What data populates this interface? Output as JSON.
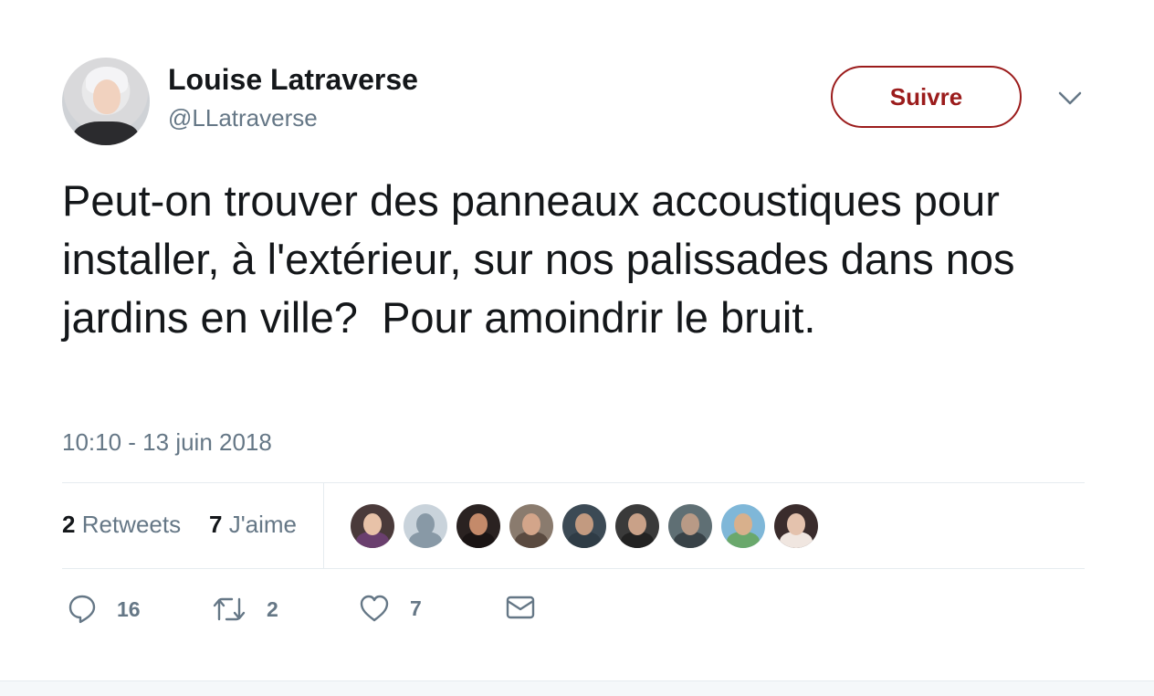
{
  "author": {
    "name": "Louise Latraverse",
    "handle": "@LLatraverse"
  },
  "follow_button": {
    "label": "Suivre"
  },
  "tweet": {
    "text": "Peut-on trouver des panneaux accoustiques pour installer, à l'extérieur, sur nos palissades dans nos jardins en ville?  Pour amoindrir le bruit.",
    "timestamp": "10:10 - 13 juin 2018"
  },
  "stats": {
    "retweets_count": "2",
    "retweets_label": "Retweets",
    "likes_count": "7",
    "likes_label": "J'aime"
  },
  "likers": [
    {
      "icon": "avatar-woman-dark-hair",
      "bg": "#4a3a3a",
      "face": "#e8c2a8",
      "body": "#6a3f6e"
    },
    {
      "icon": "avatar-default-silhouette",
      "bg": "#c9d3db",
      "face": "#8899a6",
      "body": "#8899a6"
    },
    {
      "icon": "avatar-woman-black-hair",
      "bg": "#2a2221",
      "face": "#c48a6a",
      "body": "#1a1414"
    },
    {
      "icon": "avatar-man-beard",
      "bg": "#8a7b6e",
      "face": "#d3a58a",
      "body": "#5a4a40"
    },
    {
      "icon": "avatar-man-glasses",
      "bg": "#3c4a55",
      "face": "#c29a80",
      "body": "#2f3c46"
    },
    {
      "icon": "avatar-man-bald",
      "bg": "#3a3a3a",
      "face": "#c9a188",
      "body": "#222222"
    },
    {
      "icon": "avatar-two-people",
      "bg": "#5f6f74",
      "face": "#b89a86",
      "body": "#384247"
    },
    {
      "icon": "avatar-person-outdoors",
      "bg": "#7fb7d8",
      "face": "#d8b08c",
      "body": "#6aa86c"
    },
    {
      "icon": "avatar-woman-blonde",
      "bg": "#3a2c2c",
      "face": "#e4c2ad",
      "body": "#f0e6e0"
    }
  ],
  "actions": {
    "reply_count": "16",
    "retweet_count": "2",
    "like_count": "7"
  },
  "colors": {
    "follow_accent": "#9b1c1c",
    "secondary_text": "#657786",
    "divider": "#e6ecf0"
  }
}
